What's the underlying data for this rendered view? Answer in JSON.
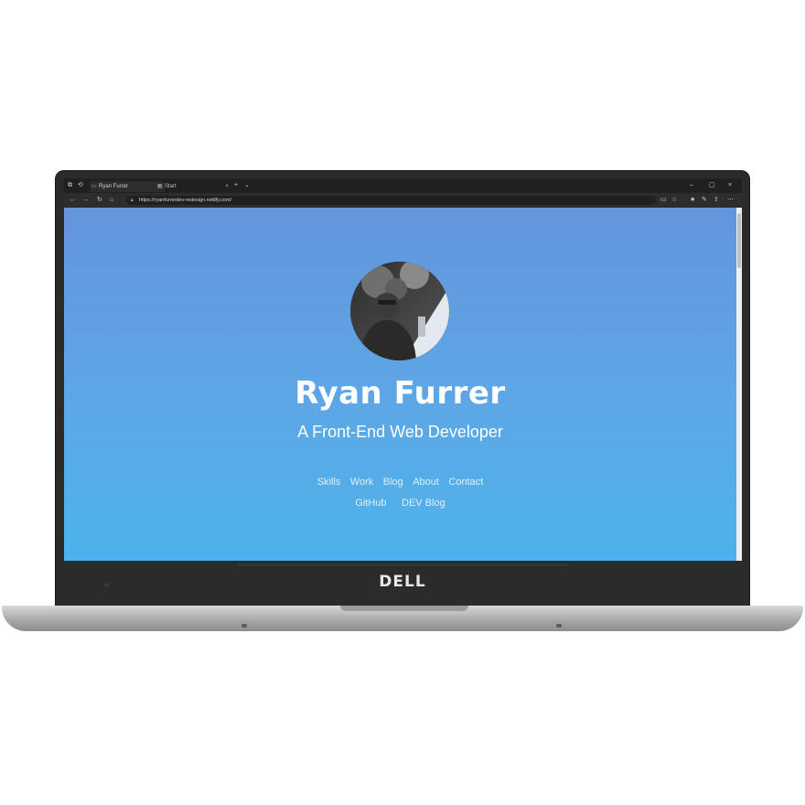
{
  "browser": {
    "tabs": [
      {
        "label": "Ryan Furrer",
        "active": true
      },
      {
        "label": "Start",
        "active": false
      }
    ],
    "url": "https://ryanfurrerdev-redesign.netlify.com/"
  },
  "page": {
    "name": "Ryan Furrer",
    "tagline": "A Front-End Web Developer",
    "nav": [
      "Skills",
      "Work",
      "Blog",
      "About",
      "Contact"
    ],
    "nav_secondary": [
      "GitHub",
      "DEV Blog"
    ]
  },
  "device": {
    "brand": "DELL"
  },
  "colors": {
    "gradient_top": "#6495dc",
    "gradient_bottom": "#4db3ea",
    "chrome_dark": "#202020",
    "bezel": "#2b2b2b"
  }
}
